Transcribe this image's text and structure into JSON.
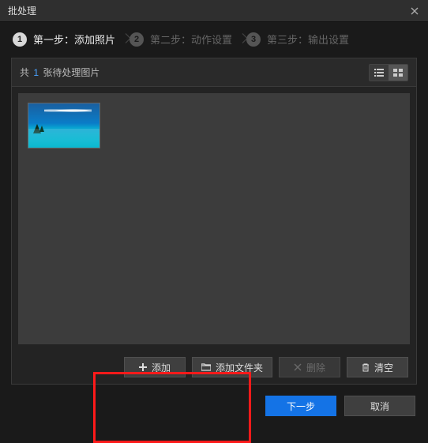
{
  "window": {
    "title": "批处理"
  },
  "steps": [
    {
      "num": "1",
      "label": "第一步：添加照片",
      "active": true
    },
    {
      "num": "2",
      "label": "第二步：动作设置",
      "active": false
    },
    {
      "num": "3",
      "label": "第三步：输出设置",
      "active": false
    }
  ],
  "panel": {
    "count_prefix": "共",
    "count_value": "1",
    "count_suffix": "张待处理图片"
  },
  "toolbar": {
    "add": "添加",
    "add_folder": "添加文件夹",
    "delete": "删除",
    "clear": "清空"
  },
  "footer": {
    "next": "下一步",
    "cancel": "取消"
  }
}
